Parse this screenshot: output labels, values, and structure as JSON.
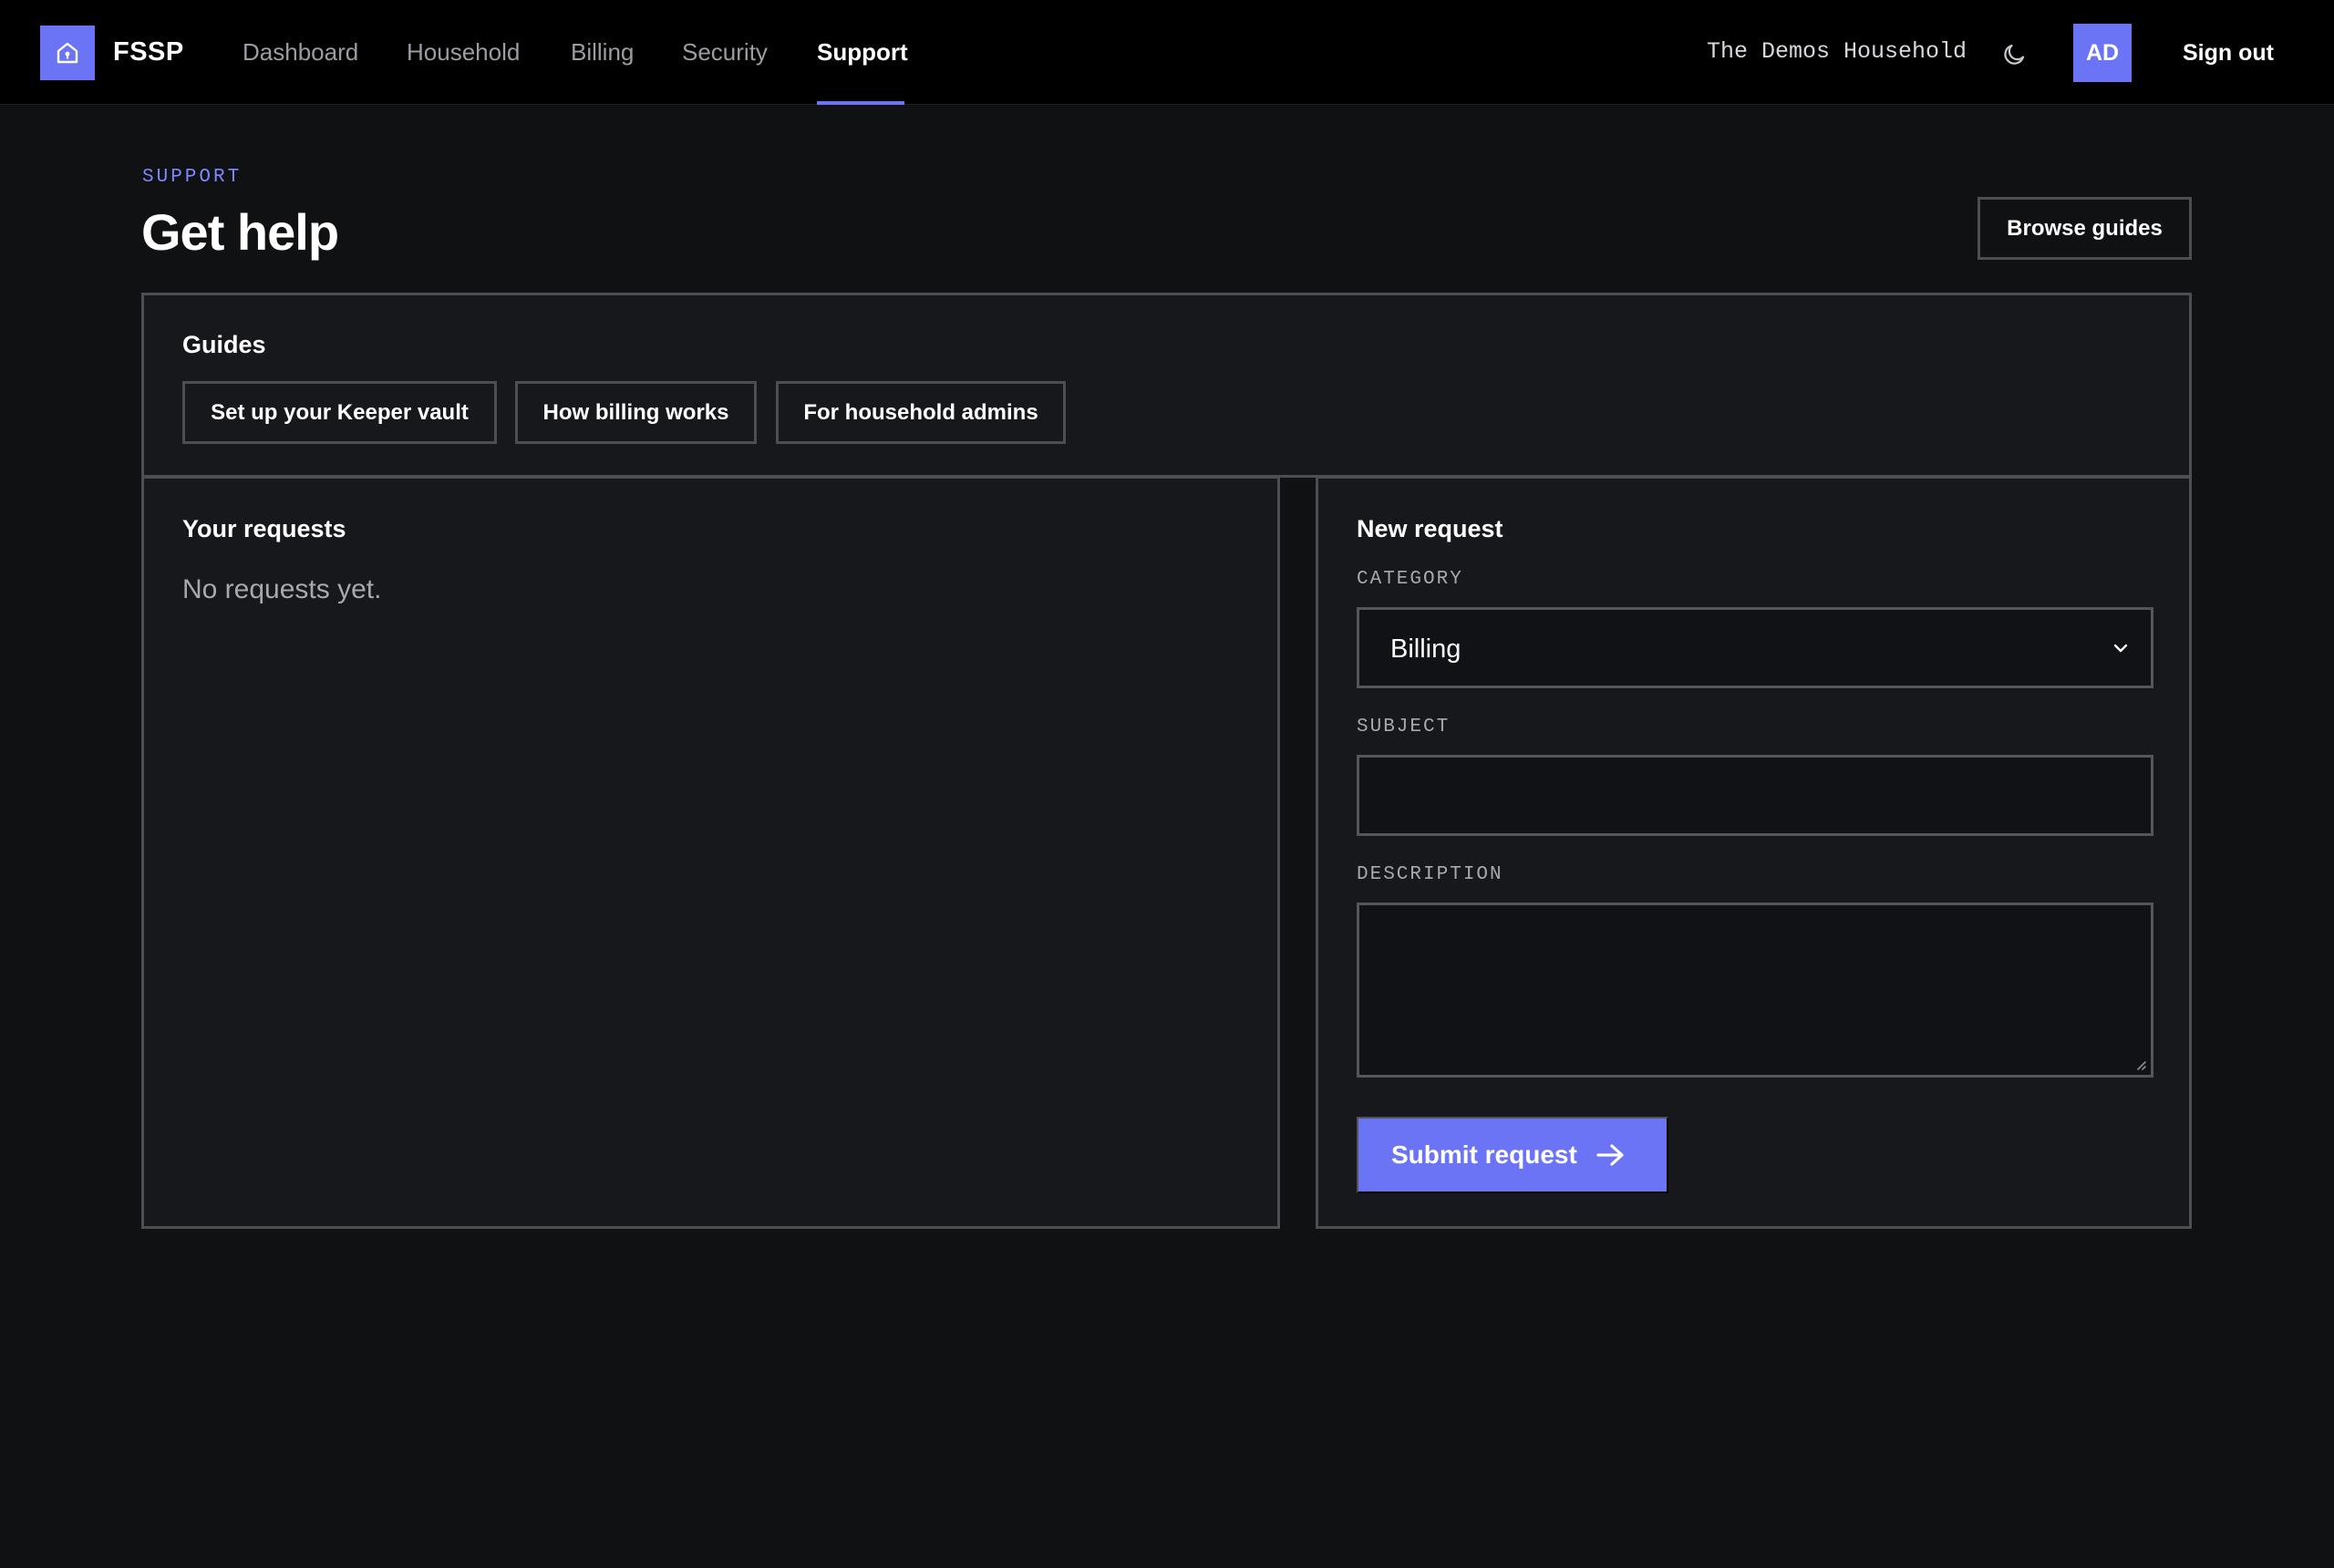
{
  "brand": {
    "name": "FSSP",
    "logo_icon": "home-lock-icon"
  },
  "nav": {
    "items": [
      {
        "label": "Dashboard",
        "active": false
      },
      {
        "label": "Household",
        "active": false
      },
      {
        "label": "Billing",
        "active": false
      },
      {
        "label": "Security",
        "active": false
      },
      {
        "label": "Support",
        "active": true
      }
    ]
  },
  "account": {
    "household": "The Demos Household",
    "theme_icon": "moon-icon",
    "avatar_initials": "AD",
    "sign_out_label": "Sign out"
  },
  "page": {
    "eyebrow": "SUPPORT",
    "title": "Get help",
    "browse_guides_label": "Browse guides"
  },
  "guides": {
    "title": "Guides",
    "items": [
      {
        "label": "Set up your Keeper vault"
      },
      {
        "label": "How billing works"
      },
      {
        "label": "For household admins"
      }
    ]
  },
  "requests": {
    "title": "Your requests",
    "empty_text": "No requests yet."
  },
  "new_request": {
    "title": "New request",
    "category": {
      "label": "CATEGORY",
      "value": "Billing"
    },
    "subject": {
      "label": "SUBJECT",
      "value": "",
      "placeholder": ""
    },
    "description": {
      "label": "DESCRIPTION",
      "value": "",
      "placeholder": ""
    },
    "submit_label": "Submit request",
    "submit_icon": "arrow-right-icon"
  },
  "colors": {
    "accent": "#6b74f5",
    "background": "#101113",
    "panel": "#17181c",
    "border": "#4d4e53",
    "topbar": "#000000"
  }
}
